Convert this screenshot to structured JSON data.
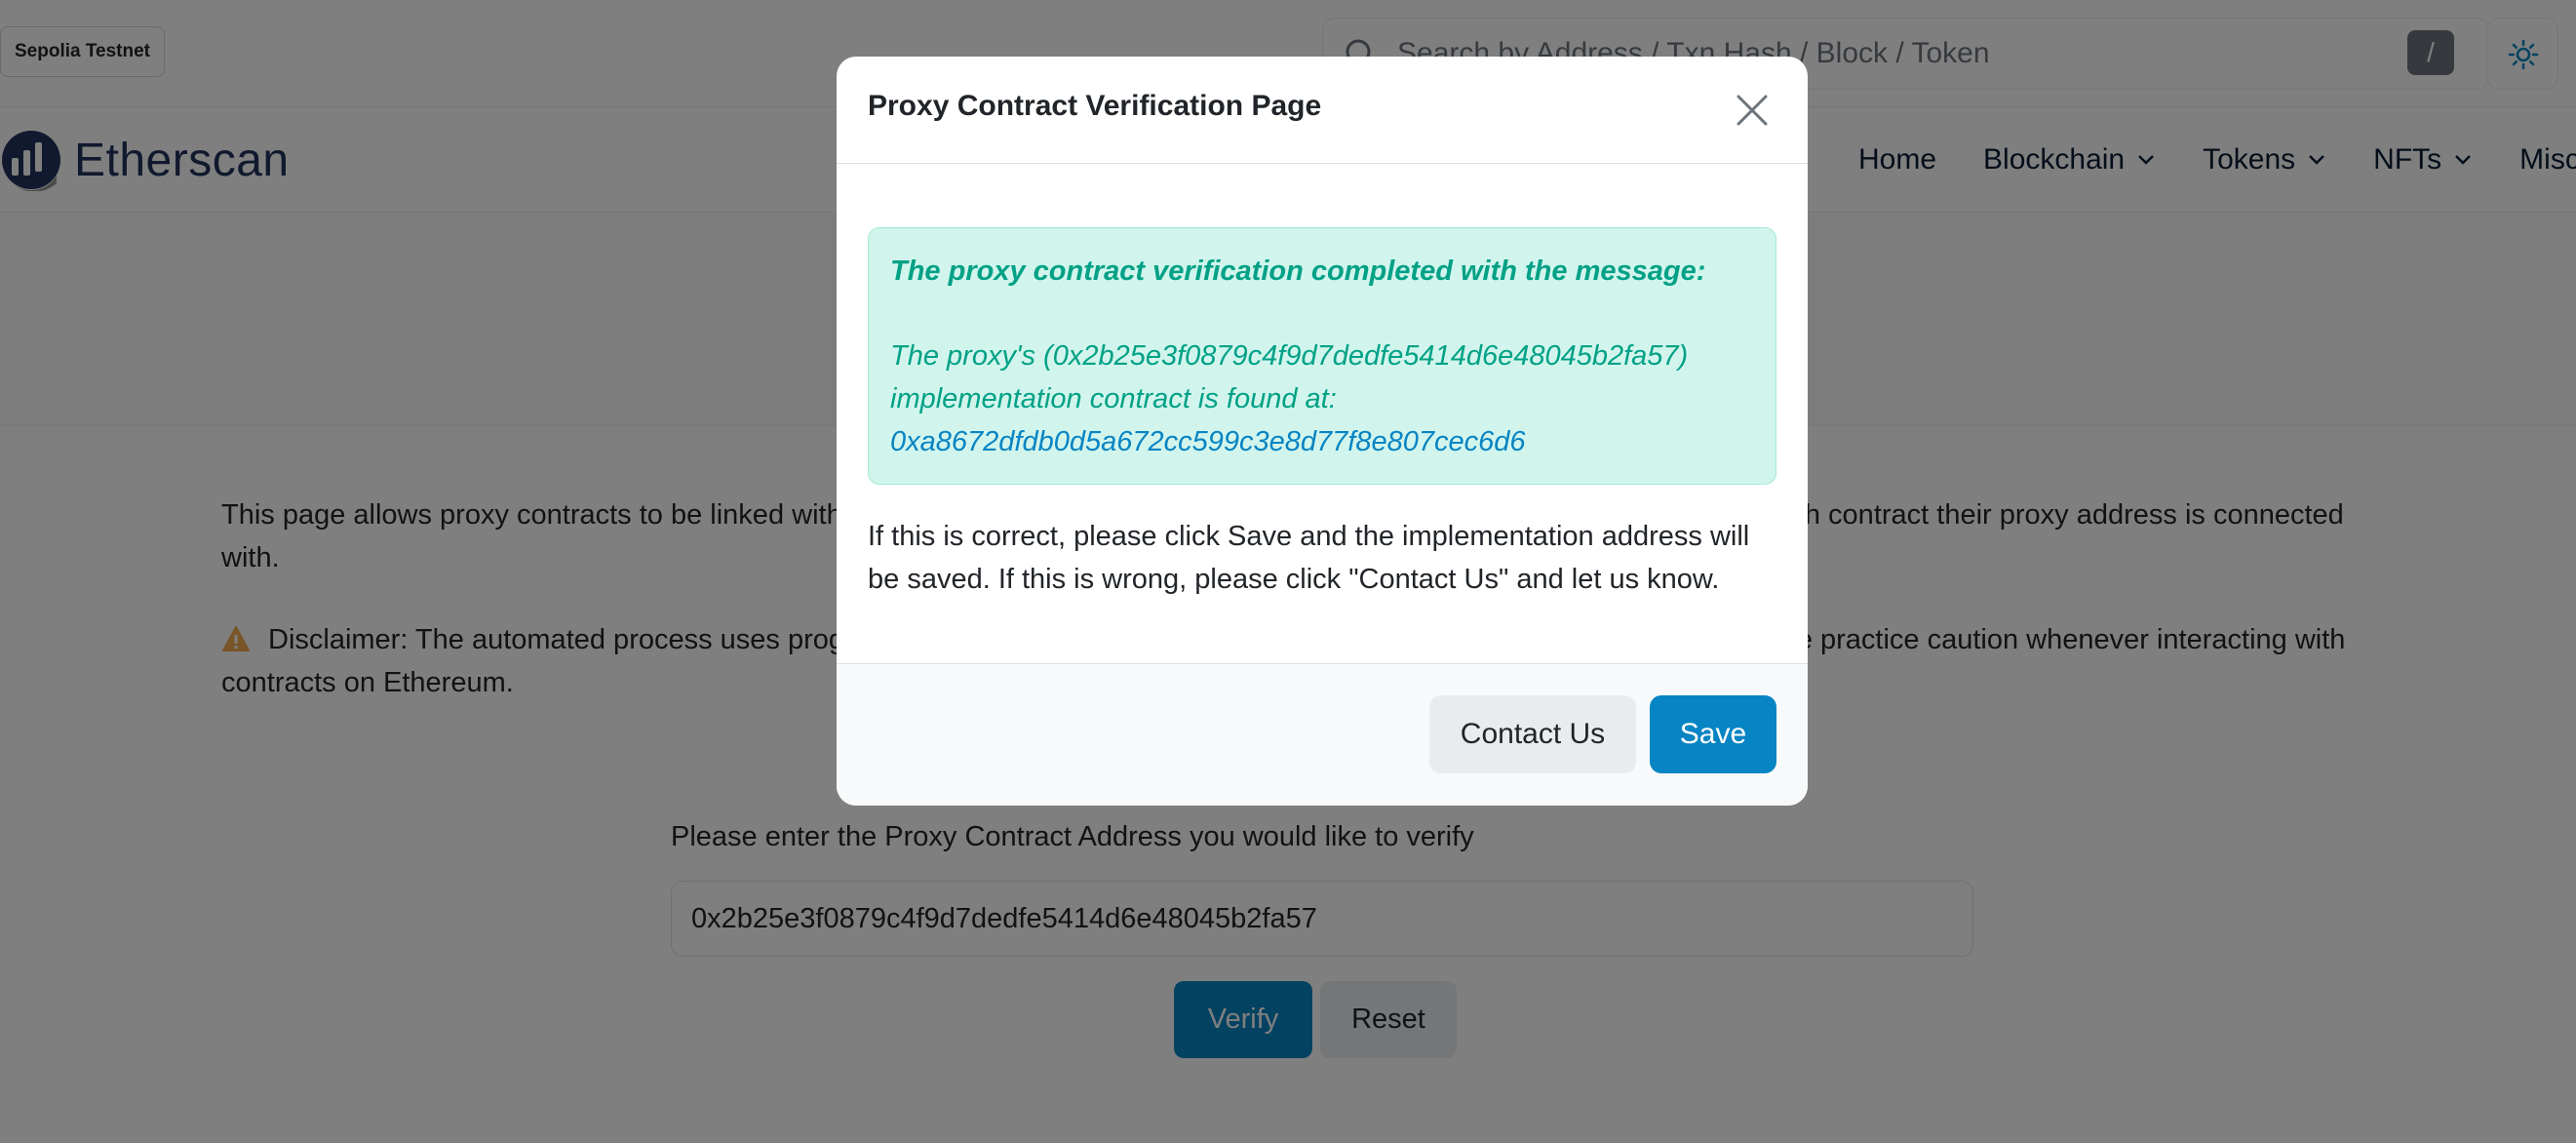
{
  "topbar": {
    "network_badge": "Sepolia Testnet",
    "search_placeholder": "Search by Address / Txn Hash / Block / Token",
    "search_shortcut": "/",
    "theme_icon": "sun-icon"
  },
  "navbar": {
    "logo_text": "Etherscan",
    "items": [
      {
        "label": "Home",
        "has_dropdown": false
      },
      {
        "label": "Blockchain",
        "has_dropdown": true
      },
      {
        "label": "Tokens",
        "has_dropdown": true
      },
      {
        "label": "NFTs",
        "has_dropdown": true
      },
      {
        "label": "Misc",
        "has_dropdown": true
      }
    ]
  },
  "page": {
    "description": "This page allows proxy contracts to be linked with their implementation contract ABI's, allowing users to interact and know which contract their proxy address is connected with.",
    "disclaimer": "Disclaimer: The automated process uses programmatic analysis to flag and identify the contract as a proxy contract. Please practice caution whenever interacting with contracts on Ethereum.",
    "form_label": "Please enter the Proxy Contract Address you would like to verify",
    "address_value": "0x2b25e3f0879c4f9d7dedfe5414d6e48045b2fa57",
    "verify_label": "Verify",
    "reset_label": "Reset"
  },
  "modal": {
    "title": "Proxy Contract Verification Page",
    "alert_heading": "The proxy contract verification completed with the message:",
    "alert_text": "The proxy's (0x2b25e3f0879c4f9d7dedfe5414d6e48045b2fa57) implementation contract is found at:",
    "implementation_address": "0xa8672dfdb0d5a672cc599c3e8d77f8e807cec6d6",
    "body_text": "If this is correct, please click Save and the implementation address will be saved. If this is wrong, please click \"Contact Us\" and let us know.",
    "contact_label": "Contact Us",
    "save_label": "Save"
  },
  "colors": {
    "accent": "#0784c3",
    "success_text": "#00a186",
    "success_bg": "#d1f5ec",
    "brand_navy": "#21325b",
    "warning": "#f0ad4e"
  }
}
